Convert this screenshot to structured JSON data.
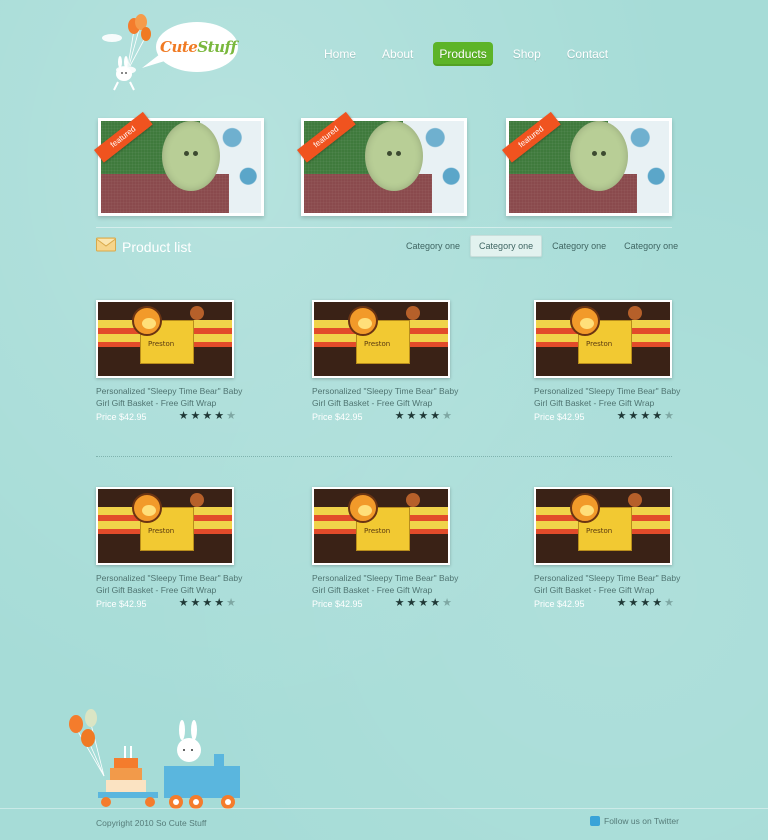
{
  "brand": {
    "name_a": "Cute",
    "name_b": "Stuff"
  },
  "nav": {
    "items": [
      {
        "label": "Home"
      },
      {
        "label": "About"
      },
      {
        "label": "Products"
      },
      {
        "label": "Shop"
      },
      {
        "label": "Contact"
      }
    ],
    "active_index": 2
  },
  "featured": {
    "ribbon_label": "featured",
    "count": 3
  },
  "product_list": {
    "title": "Product list",
    "categories": [
      {
        "label": "Category one"
      },
      {
        "label": "Category one"
      },
      {
        "label": "Category one"
      },
      {
        "label": "Category one"
      }
    ],
    "active_category_index": 1,
    "products": [
      {
        "title": "Personalized \"Sleepy Time Bear\" Baby Girl Gift Basket - Free Gift Wrap",
        "price": "Price $42.95",
        "rating": 4,
        "max_rating": 5,
        "photo_text": "Preston"
      },
      {
        "title": "Personalized \"Sleepy Time Bear\" Baby Girl Gift Basket - Free Gift Wrap",
        "price": "Price $42.95",
        "rating": 4,
        "max_rating": 5,
        "photo_text": "Preston"
      },
      {
        "title": "Personalized \"Sleepy Time Bear\" Baby Girl Gift Basket - Free Gift Wrap",
        "price": "Price $42.95",
        "rating": 4,
        "max_rating": 5,
        "photo_text": "Preston"
      },
      {
        "title": "Personalized \"Sleepy Time Bear\" Baby Girl Gift Basket - Free Gift Wrap",
        "price": "Price $42.95",
        "rating": 4,
        "max_rating": 5,
        "photo_text": "Preston"
      },
      {
        "title": "Personalized \"Sleepy Time Bear\" Baby Girl Gift Basket - Free Gift Wrap",
        "price": "Price $42.95",
        "rating": 4,
        "max_rating": 5,
        "photo_text": "Preston"
      },
      {
        "title": "Personalized \"Sleepy Time Bear\" Baby Girl Gift Basket - Free Gift Wrap",
        "price": "Price $42.95",
        "rating": 4,
        "max_rating": 5,
        "photo_text": "Preston"
      }
    ]
  },
  "footer": {
    "copyright": "Copyright 2010 So Cute Stuff",
    "follow_label": "Follow us on Twitter"
  },
  "colors": {
    "background": "#a6dcd7",
    "nav_active": "#5db428",
    "logo_orange": "#f07a23",
    "logo_green": "#7ab83d",
    "ribbon": "#f0531f"
  },
  "icons": [
    "bunny-balloons-icon",
    "envelope-icon",
    "star-icon",
    "twitter-icon",
    "birthday-train-icon"
  ]
}
